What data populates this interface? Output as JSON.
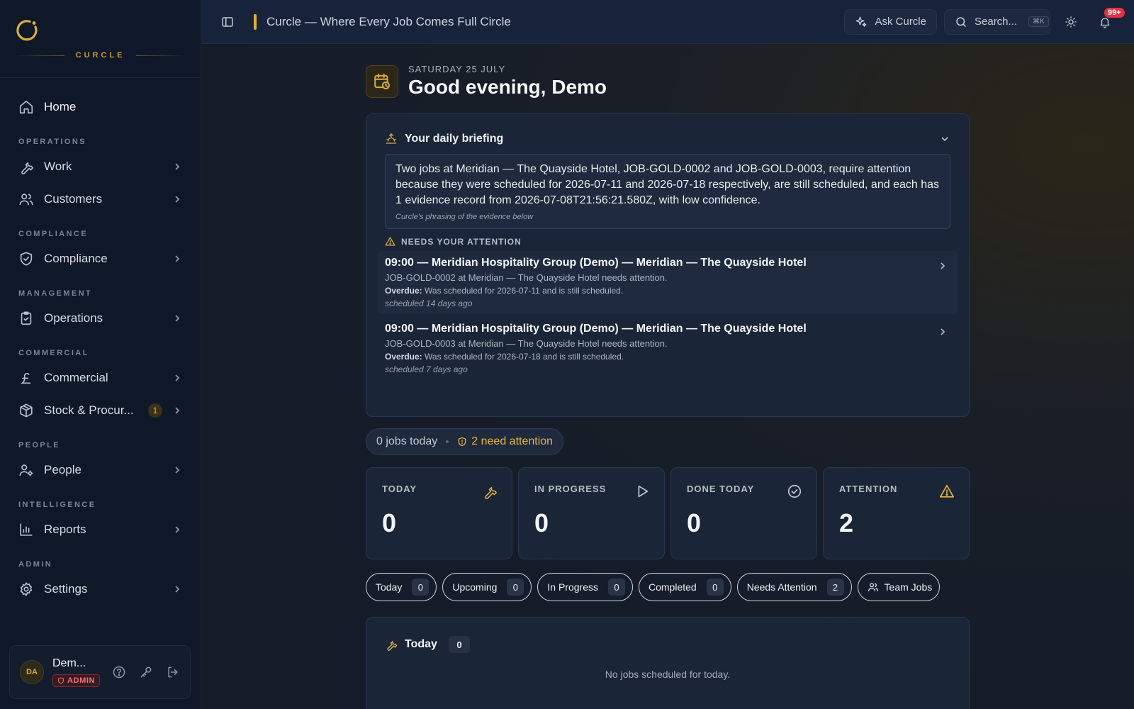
{
  "brand": {
    "name": "CURCLE"
  },
  "sidebar": {
    "home": "Home",
    "sections": [
      {
        "title": "OPERATIONS",
        "items": [
          {
            "label": "Work",
            "icon": "wrench-icon"
          },
          {
            "label": "Customers",
            "icon": "users-icon"
          }
        ]
      },
      {
        "title": "COMPLIANCE",
        "items": [
          {
            "label": "Compliance",
            "icon": "shield-check-icon"
          }
        ]
      },
      {
        "title": "MANAGEMENT",
        "items": [
          {
            "label": "Operations",
            "icon": "clipboard-check-icon"
          }
        ]
      },
      {
        "title": "COMMERCIAL",
        "items": [
          {
            "label": "Commercial",
            "icon": "pound-icon"
          },
          {
            "label": "Stock & Procur...",
            "icon": "package-icon",
            "badge": "1"
          }
        ]
      },
      {
        "title": "PEOPLE",
        "items": [
          {
            "label": "People",
            "icon": "user-cog-icon"
          }
        ]
      },
      {
        "title": "INTELLIGENCE",
        "items": [
          {
            "label": "Reports",
            "icon": "bar-chart-icon"
          }
        ]
      },
      {
        "title": "ADMIN",
        "items": [
          {
            "label": "Settings",
            "icon": "gear-icon"
          }
        ]
      }
    ],
    "user": {
      "initials": "DA",
      "name": "Dem...",
      "role": "ADMIN"
    }
  },
  "topbar": {
    "title": "Curcle — Where Every Job Comes Full Circle",
    "ask": "Ask Curcle",
    "search_placeholder": "Search...",
    "search_kbd": "⌘K",
    "notifications": "99+"
  },
  "greeting": {
    "date": "SATURDAY 25 JULY",
    "title": "Good evening, Demo"
  },
  "briefing": {
    "title": "Your daily briefing",
    "text": "Two jobs at Meridian — The Quayside Hotel, JOB-GOLD-0002 and JOB-GOLD-0003, require attention because they were scheduled for 2026-07-11 and 2026-07-18 respectively, are still scheduled, and each has 1 evidence record from 2026-07-08T21:56:21.580Z, with low confidence.",
    "note": "Curcle's phrasing of the evidence below",
    "attention_title": "NEEDS YOUR ATTENTION",
    "items": [
      {
        "title": "09:00 — Meridian Hospitality Group (Demo) — Meridian — The Quayside Hotel",
        "subtitle": "JOB-GOLD-0002 at Meridian — The Quayside Hotel needs attention.",
        "overdue_label": "Overdue:",
        "overdue_text": " Was scheduled for 2026-07-11 and is still scheduled.",
        "ago": "scheduled 14 days ago"
      },
      {
        "title": "09:00 — Meridian Hospitality Group (Demo) — Meridian — The Quayside Hotel",
        "subtitle": "JOB-GOLD-0003 at Meridian — The Quayside Hotel needs attention.",
        "overdue_label": "Overdue:",
        "overdue_text": " Was scheduled for 2026-07-18 and is still scheduled.",
        "ago": "scheduled 7 days ago"
      }
    ]
  },
  "summary": {
    "jobs": "0 jobs today",
    "attention": "2 need attention"
  },
  "stats": [
    {
      "label": "TODAY",
      "value": "0",
      "icon": "wrench-icon",
      "color": "#d9ad3c"
    },
    {
      "label": "IN PROGRESS",
      "value": "0",
      "icon": "play-icon",
      "color": "#c3cad5"
    },
    {
      "label": "DONE TODAY",
      "value": "0",
      "icon": "check-circle-icon",
      "color": "#c3cad5"
    },
    {
      "label": "ATTENTION",
      "value": "2",
      "icon": "warning-icon",
      "color": "#e6b73a"
    }
  ],
  "filters": [
    {
      "label": "Today",
      "count": "0"
    },
    {
      "label": "Upcoming",
      "count": "0"
    },
    {
      "label": "In Progress",
      "count": "0"
    },
    {
      "label": "Completed",
      "count": "0"
    },
    {
      "label": "Needs Attention",
      "count": "2"
    },
    {
      "label": "Team Jobs"
    }
  ],
  "today": {
    "title": "Today",
    "count": "0",
    "empty": "No jobs scheduled for today."
  }
}
